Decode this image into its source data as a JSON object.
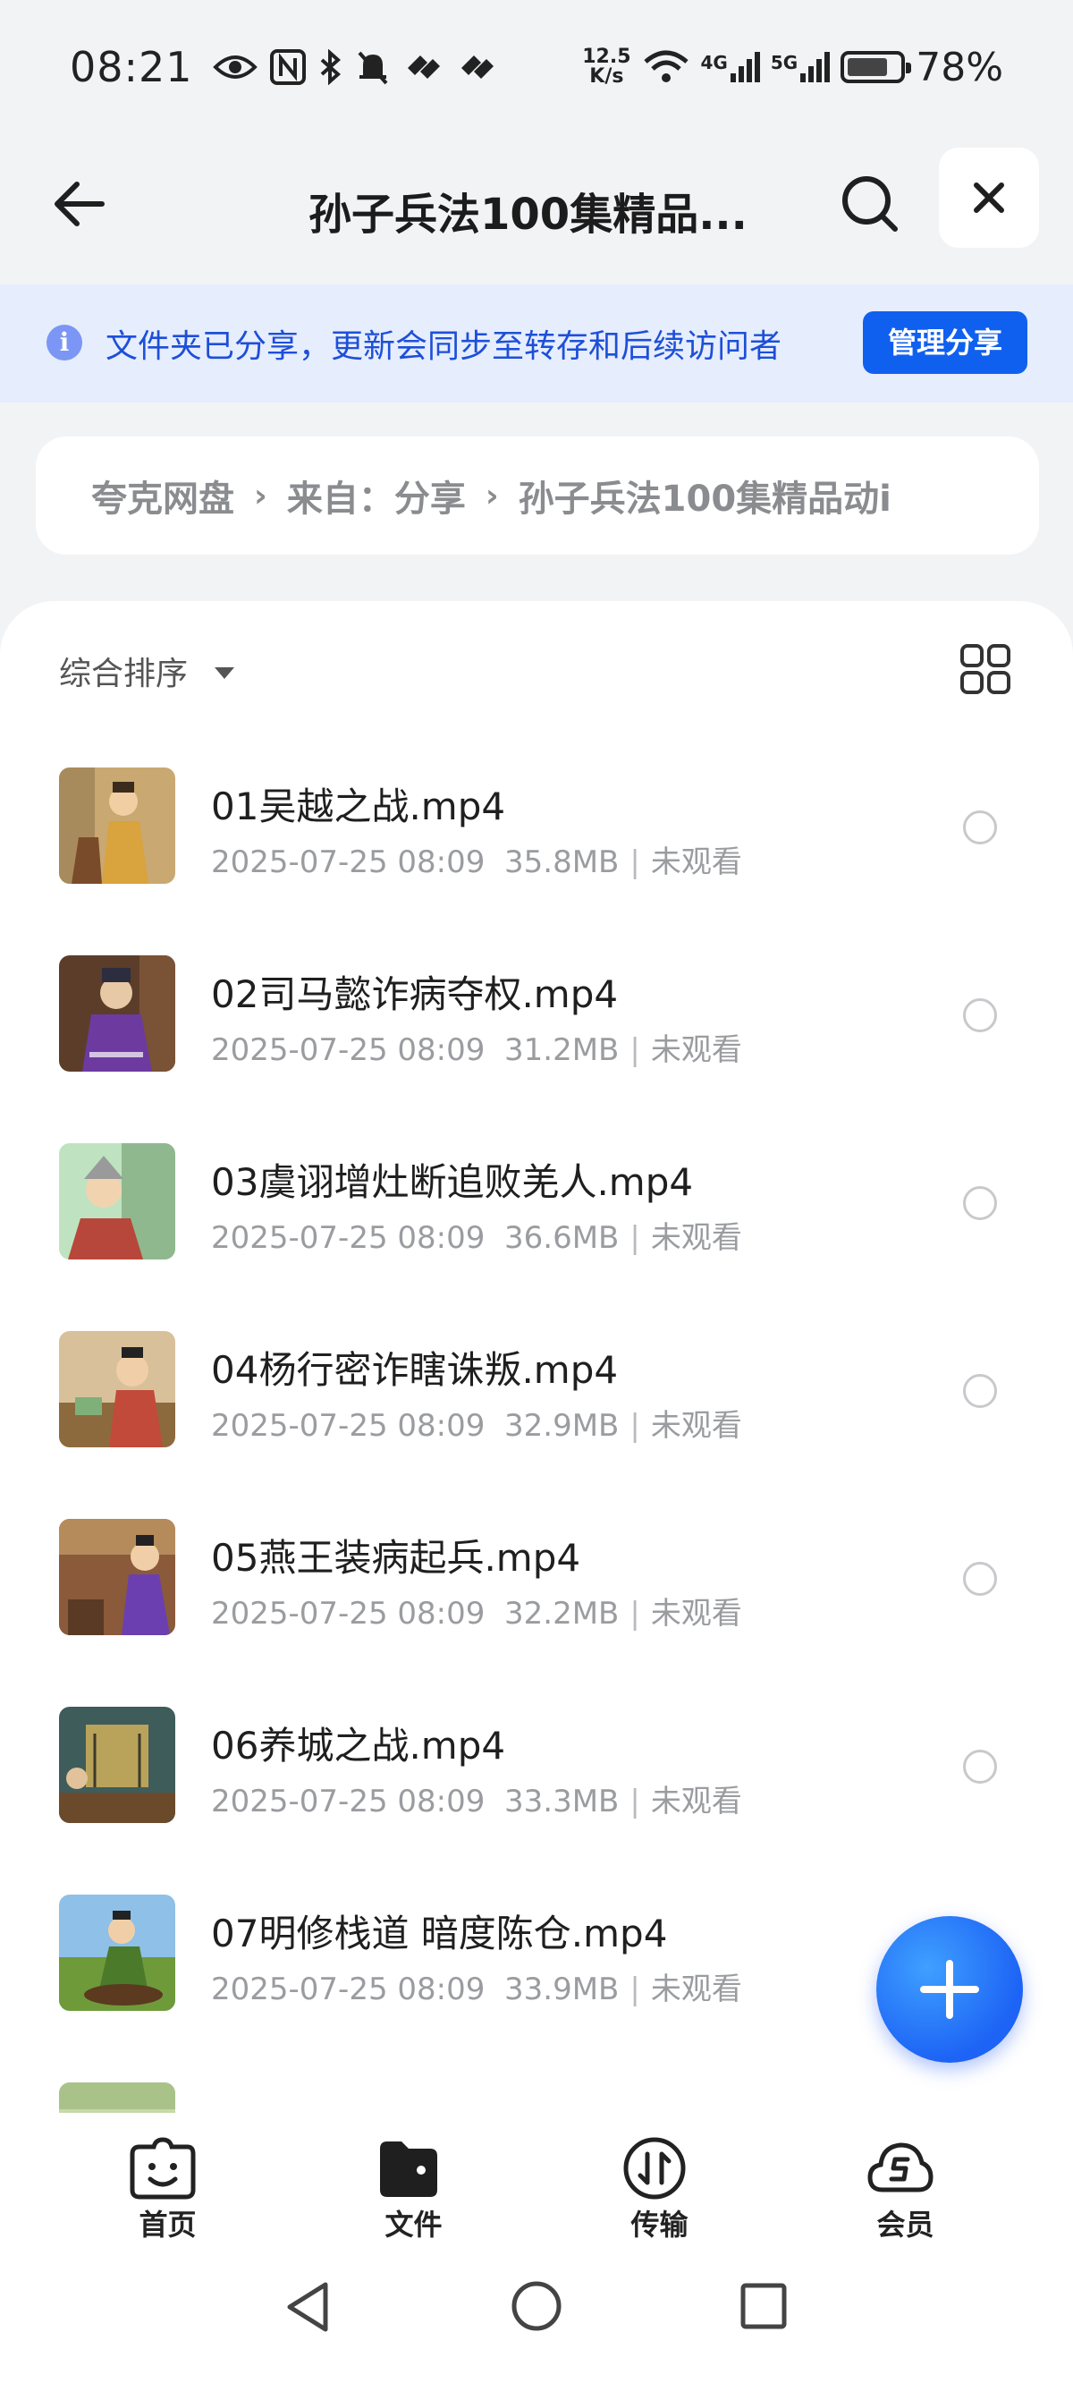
{
  "status_bar": {
    "time": "08:21",
    "net_speed_value": "12.5",
    "net_speed_unit": "K/s",
    "signal_1": "4G",
    "signal_2": "5G",
    "battery": "78%"
  },
  "header": {
    "title": "孙子兵法100集精品..."
  },
  "share_banner": {
    "info_glyph": "i",
    "text": "文件夹已分享，更新会同步至转存和后续访问者",
    "button_label": "管理分享"
  },
  "breadcrumb": {
    "items": [
      "夸克网盘",
      "来自：分享",
      "孙子兵法100集精品动i"
    ]
  },
  "sort": {
    "label": "综合排序"
  },
  "files": [
    {
      "name": "01吴越之战.mp4",
      "date": "2025-07-25 08:09",
      "size": "35.8MB",
      "status": "未观看"
    },
    {
      "name": "02司马懿诈病夺权.mp4",
      "date": "2025-07-25 08:09",
      "size": "31.2MB",
      "status": "未观看"
    },
    {
      "name": "03虞诩增灶断追败羌人.mp4",
      "date": "2025-07-25 08:09",
      "size": "36.6MB",
      "status": "未观看"
    },
    {
      "name": "04杨行密诈瞎诛叛.mp4",
      "date": "2025-07-25 08:09",
      "size": "32.9MB",
      "status": "未观看"
    },
    {
      "name": "05燕王装病起兵.mp4",
      "date": "2025-07-25 08:09",
      "size": "32.2MB",
      "status": "未观看"
    },
    {
      "name": "06养城之战.mp4",
      "date": "2025-07-25 08:09",
      "size": "33.3MB",
      "status": "未观看"
    },
    {
      "name": "07明修栈道 暗度陈仓.mp4",
      "date": "2025-07-25 08:09",
      "size": "33.9MB",
      "status": "未观看"
    }
  ],
  "bottom_nav": {
    "items": [
      {
        "label": "首页",
        "icon": "home-smile-icon"
      },
      {
        "label": "文件",
        "icon": "folder-icon"
      },
      {
        "label": "传输",
        "icon": "transfer-icon"
      },
      {
        "label": "会员",
        "icon": "member-cloud-icon"
      }
    ]
  },
  "colors": {
    "accent": "#1060f0",
    "banner_bg": "#e6edfd",
    "banner_text": "#1d4fd8"
  }
}
